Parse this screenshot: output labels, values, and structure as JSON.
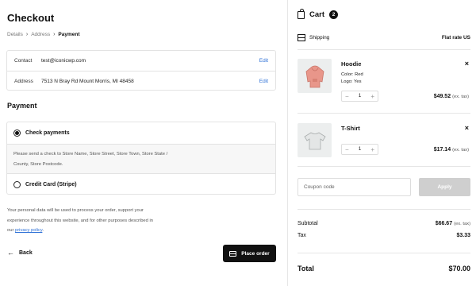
{
  "page": {
    "title": "Checkout"
  },
  "breadcrumb": {
    "items": [
      "Details",
      "Address",
      "Payment"
    ]
  },
  "info": {
    "contact_label": "Contact",
    "contact_value": "test@iconicwp.com",
    "contact_edit": "Edit",
    "address_label": "Address",
    "address_value": "7513 N Bray Rd Mount Morris, MI 48458",
    "address_edit": "Edit"
  },
  "payment": {
    "heading": "Payment",
    "options": [
      {
        "label": "Check payments",
        "selected": true
      },
      {
        "label": "Credit Card (Stripe)",
        "selected": false
      }
    ],
    "description_lines": [
      "Please send a check to Store Name, Store Street, Store Town, Store State /",
      "County, Store Postcode."
    ]
  },
  "privacy": {
    "lines": [
      "Your personal data will be used to process your order, support your",
      "experience throughout this website, and for other purposes described in"
    ],
    "prefix": "our ",
    "link": "privacy policy",
    "suffix": "."
  },
  "actions": {
    "back": "Back",
    "place_order": "Place order"
  },
  "cart": {
    "title": "Cart",
    "count": "2",
    "shipping_label": "Shipping",
    "shipping_value": "Flat rate US",
    "items": [
      {
        "name": "Hoodie",
        "meta": [
          "Color: Red",
          "Logo: Yes"
        ],
        "qty": "1",
        "price": "$49.52",
        "tax_note": "(ex. tax)",
        "color": "#e8968a"
      },
      {
        "name": "T-Shirt",
        "meta": [],
        "qty": "1",
        "price": "$17.14",
        "tax_note": "(ex. tax)",
        "color": "#d6dadb"
      }
    ],
    "coupon_placeholder": "Coupon code",
    "apply": "Apply",
    "subtotal_label": "Subtotal",
    "subtotal_value": "$66.67",
    "subtotal_note": "(ex. tax)",
    "tax_label": "Tax",
    "tax_value": "$3.33",
    "total_label": "Total",
    "total_value": "$70.00"
  }
}
